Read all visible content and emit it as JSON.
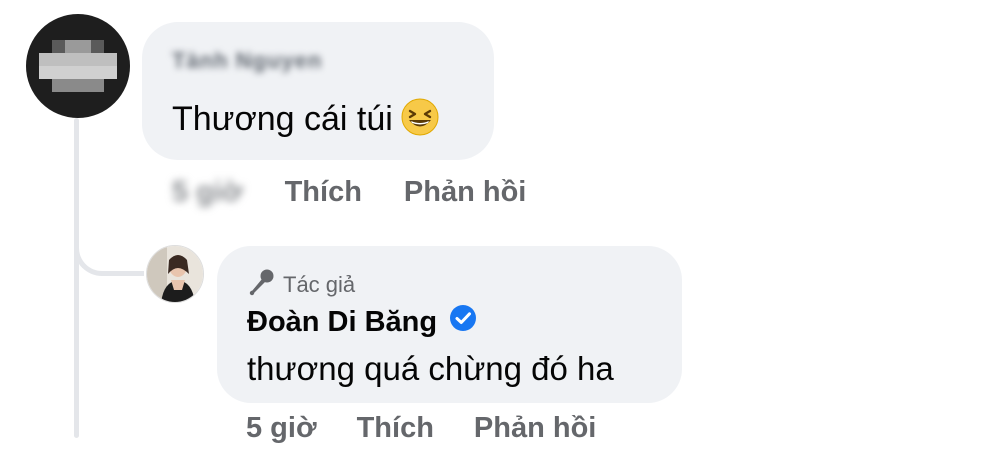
{
  "main_comment": {
    "author_name": "Tành Nguyen",
    "text": "Thương cái túi",
    "emoji": "grinning-squinting-face-icon",
    "time": "5 giờ",
    "like_label": "Thích",
    "reply_label": "Phản hồi"
  },
  "reply": {
    "author_badge": "Tác giả",
    "author_name": "Đoàn Di Băng",
    "text": "thương quá chừng đó ha",
    "time": "5 giờ",
    "like_label": "Thích",
    "reply_label": "Phản hồi"
  },
  "colors": {
    "bubble_bg": "#f0f2f5",
    "secondary_text": "#65676b",
    "verified_blue": "#1877f2",
    "emoji_yellow": "#f7c948"
  }
}
